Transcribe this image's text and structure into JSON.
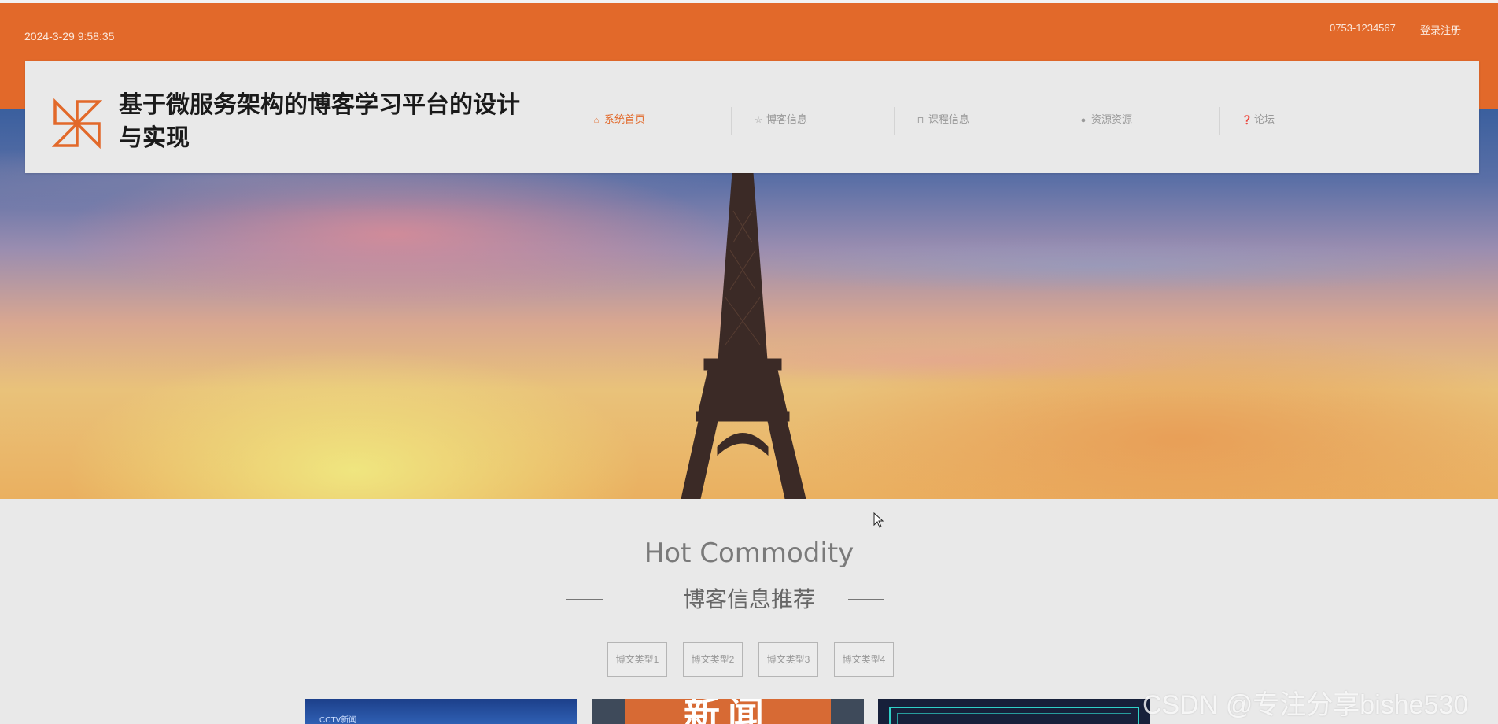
{
  "topbar": {
    "datetime": "2024-3-29 9:58:35",
    "phone": "0753-1234567",
    "login_label": "登录注册"
  },
  "header": {
    "title": "基于微服务架构的博客学习平台的设计与实现",
    "nav": [
      {
        "label": "系统首页",
        "icon": "home-icon",
        "active": true
      },
      {
        "label": "博客信息",
        "icon": "star-icon",
        "active": false
      },
      {
        "label": "课程信息",
        "icon": "lock-icon",
        "active": false
      },
      {
        "label": "资源资源",
        "icon": "circle-icon",
        "active": false
      },
      {
        "label": "论坛",
        "icon": "help-icon",
        "active": false
      }
    ]
  },
  "section": {
    "title_en": "Hot Commodity",
    "title_cn": "博客信息推荐",
    "filters": [
      "博文类型1",
      "博文类型2",
      "博文类型3",
      "博文类型4"
    ]
  },
  "cards": [
    {
      "tag": "CCTV新闻"
    },
    {
      "banner": "新闻"
    },
    {}
  ],
  "watermark": "CSDN @专注分享bishe530",
  "colors": {
    "accent": "#e2692a"
  }
}
